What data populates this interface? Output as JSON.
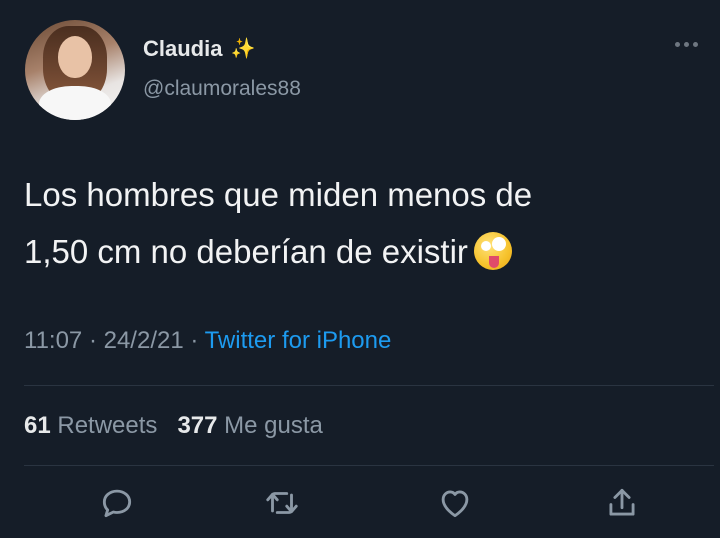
{
  "user": {
    "name": "Claudia",
    "name_emoji": "✨",
    "handle": "@claumorales88"
  },
  "tweet": {
    "text_line1": "Los hombres que miden menos de",
    "text_line2": "1,50 cm no deberían de existir",
    "emoji": "zany-face"
  },
  "meta": {
    "time": "11:07",
    "sep1": " · ",
    "date": "24/2/21",
    "sep2": " · ",
    "source": "Twitter for iPhone"
  },
  "stats": {
    "retweets_count": "61",
    "retweets_label": "Retweets",
    "likes_count": "377",
    "likes_label": "Me gusta"
  },
  "actions": [
    "reply-icon",
    "retweet-icon",
    "like-icon",
    "share-icon"
  ],
  "colors": {
    "background": "#151d28",
    "link": "#1d9bf0",
    "muted": "#8b98a5",
    "text": "#e7e9ea"
  }
}
